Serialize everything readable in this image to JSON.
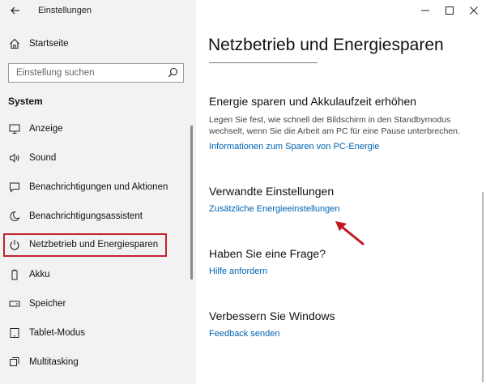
{
  "window": {
    "app_title": "Einstellungen",
    "back_icon": "back-arrow-icon",
    "controls": [
      "minimize-icon",
      "maximize-icon",
      "close-icon"
    ]
  },
  "sidebar": {
    "home_label": "Startseite",
    "search_placeholder": "Einstellung suchen",
    "section_label": "System",
    "items": [
      {
        "label": "Anzeige",
        "icon": "display-icon"
      },
      {
        "label": "Sound",
        "icon": "speaker-icon"
      },
      {
        "label": "Benachrichtigungen und Aktionen",
        "icon": "notification-icon"
      },
      {
        "label": "Benachrichtigungsassistent",
        "icon": "moon-icon"
      },
      {
        "label": "Netzbetrieb und Energiesparen",
        "icon": "power-icon",
        "selected": true
      },
      {
        "label": "Akku",
        "icon": "battery-icon"
      },
      {
        "label": "Speicher",
        "icon": "storage-icon"
      },
      {
        "label": "Tablet-Modus",
        "icon": "tablet-icon"
      },
      {
        "label": "Multitasking",
        "icon": "multitasking-icon"
      }
    ]
  },
  "main": {
    "title": "Netzbetrieb und Energiesparen",
    "energy": {
      "heading": "Energie sparen und Akkulaufzeit erhöhen",
      "description": "Legen Sie fest, wie schnell der Bildschirm in den Standbymodus wechselt, wenn Sie die Arbeit am PC für eine Pause unterbrechen.",
      "link": "Informationen zum Sparen von PC-Energie"
    },
    "related": {
      "heading": "Verwandte Einstellungen",
      "link": "Zusätzliche Energieeinstellungen"
    },
    "question": {
      "heading": "Haben Sie eine Frage?",
      "link": "Hilfe anfordern"
    },
    "improve": {
      "heading": "Verbessern Sie Windows",
      "link": "Feedback senden"
    }
  },
  "colors": {
    "accent_link": "#0063b1",
    "highlight_border": "#c0242b",
    "annotation_arrow": "#c0171f",
    "sidebar_bg": "#f2f2f2"
  }
}
